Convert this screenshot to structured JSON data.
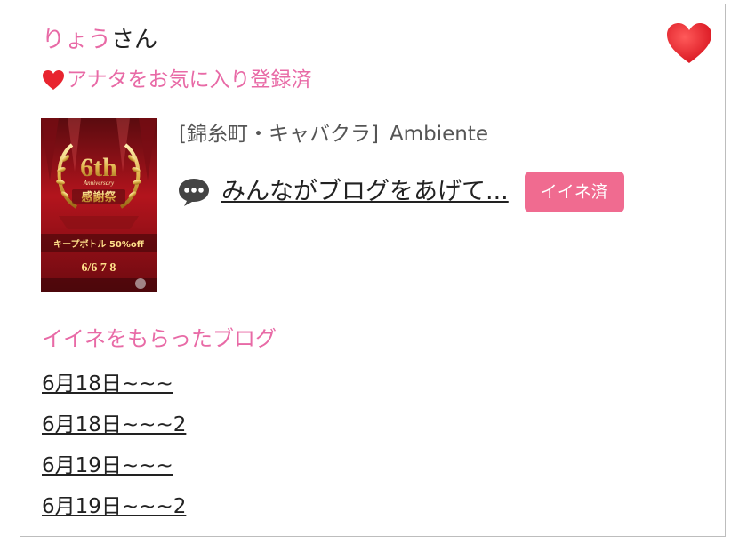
{
  "user": {
    "name": "りょう",
    "suffix": "さん"
  },
  "favorite": {
    "status_label": "アナタをお気に入り登録済",
    "heart_icon": "heart-icon",
    "heart_color": "#e8242f"
  },
  "banner": {
    "headline": "6th",
    "sub": "Anniversary",
    "event": "感謝祭",
    "offer": "キープボトル 50%off",
    "dates": "6/6 7 8"
  },
  "shop": {
    "category": "[錦糸町・キャバクラ]",
    "name": "Ambiente"
  },
  "blog": {
    "title": "みんながブログをあげて...",
    "iine_label": "イイネ済",
    "iine_color": "#f06b90"
  },
  "liked_posts": {
    "title": "イイネをもらったブログ",
    "items": [
      "6月18日~~~",
      "6月18日~~~2",
      "6月19日~~~",
      "6月19日~~~2"
    ]
  },
  "colors": {
    "accent": "#e86aa6",
    "text": "#222222",
    "border": "#bdbdbd"
  }
}
